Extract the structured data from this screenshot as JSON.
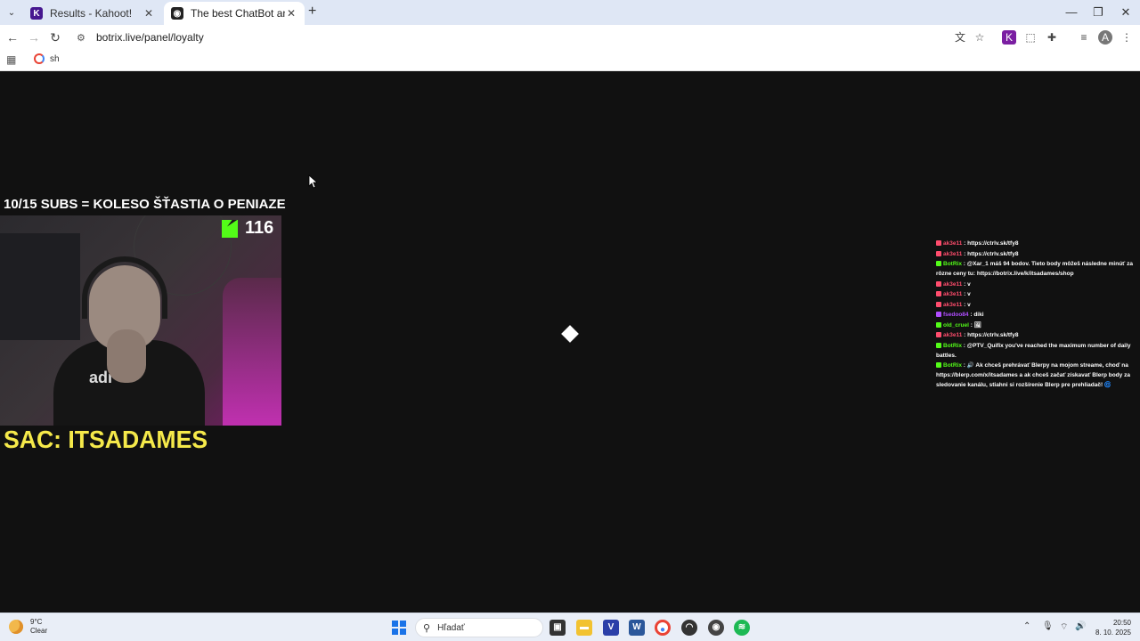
{
  "browser": {
    "tabs": [
      {
        "title": "Results - Kahoot!",
        "favicon": "kahoot-favicon",
        "favicon_letter": "K!",
        "favicon_color": "#46178f"
      },
      {
        "title": "The best ChatBot and Widgets",
        "favicon": "botrix-favicon",
        "favicon_color": "#222222"
      }
    ],
    "url": "botrix.live/panel/loyalty",
    "bookmarks": [
      {
        "label": "sh"
      }
    ],
    "window_controls": {
      "minimize": "—",
      "restore": "❐",
      "close": "✕"
    }
  },
  "stream": {
    "subs_goal": "10/15 SUBS = KOLESO ŠŤASTIA O PENIAZE",
    "kick_count": "116",
    "kick_color": "#53fc18",
    "sac_label": "SAC: ITSADAMES",
    "sac_color": "#f5e94a",
    "webcam_shirt_text": "adi"
  },
  "chat": {
    "messages": [
      {
        "user": "ak3e11",
        "user_color": "#ff4d6d",
        "text": ": https://ctrlv.sk/tfy8"
      },
      {
        "user": "ak3e11",
        "user_color": "#ff4d6d",
        "text": ": https://ctrlv.sk/tfy8"
      },
      {
        "user": "BotRix",
        "user_color": "#53fc18",
        "text": ": @Xar_1 máš 94 bodov. Tieto body môžeš následne minúť za rôzne ceny tu: https://botrix.live/k/itsadames/shop"
      },
      {
        "user": "ak3e11",
        "user_color": "#ff4d6d",
        "text": ": v"
      },
      {
        "user": "ak3e11",
        "user_color": "#ff4d6d",
        "text": ": v"
      },
      {
        "user": "ak3e11",
        "user_color": "#ff4d6d",
        "text": ": v"
      },
      {
        "user": "fsedoo84",
        "user_color": "#b04dff",
        "text": ": diki"
      },
      {
        "user": "old_cruel",
        "user_color": "#53fc18",
        "text": ": 🖼"
      },
      {
        "user": "ak3e11",
        "user_color": "#ff4d6d",
        "text": ": https://ctrlv.sk/tfy8"
      },
      {
        "user": "BotRix",
        "user_color": "#53fc18",
        "text": ": @PTV_Quifix you've reached the maximum number of daily battles."
      },
      {
        "user": "BotRix",
        "user_color": "#53fc18",
        "text": ": 🔊 Ak chceš prehrávať Blerpy na mojom streame, choď na https://blerp.com/x/itsadames a ak chceš začať získavať Blerp body za sledovanie kanálu, stiahni si rozšírenie Blerp pre prehliadač! 🌀"
      }
    ]
  },
  "taskbar": {
    "weather_temp": "9°C",
    "weather_desc": "Clear",
    "search_placeholder": "Hľadať",
    "time": "20:50",
    "date": "8. 10. 2025"
  }
}
